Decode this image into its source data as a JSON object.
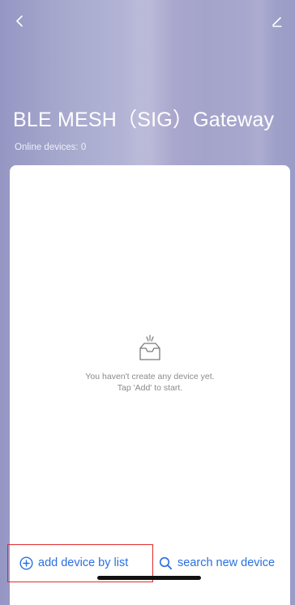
{
  "header": {
    "title": "BLE MESH（SIG）Gateway",
    "online_devices": "Online devices: 0",
    "back_icon": "chevron-left-icon",
    "edit_icon": "pencil-icon"
  },
  "empty_state": {
    "icon": "empty-inbox-icon",
    "line1": "You haven't create any device yet.",
    "line2": "Tap 'Add' to start."
  },
  "actions": {
    "add_by_list": {
      "label": "add device by list",
      "icon": "plus-circle-icon"
    },
    "search_new": {
      "label": "search new device",
      "icon": "search-icon"
    }
  },
  "colors": {
    "accent": "#2a6fe0",
    "highlight": "#e02b2b",
    "header_bg": "#a9aad0"
  }
}
